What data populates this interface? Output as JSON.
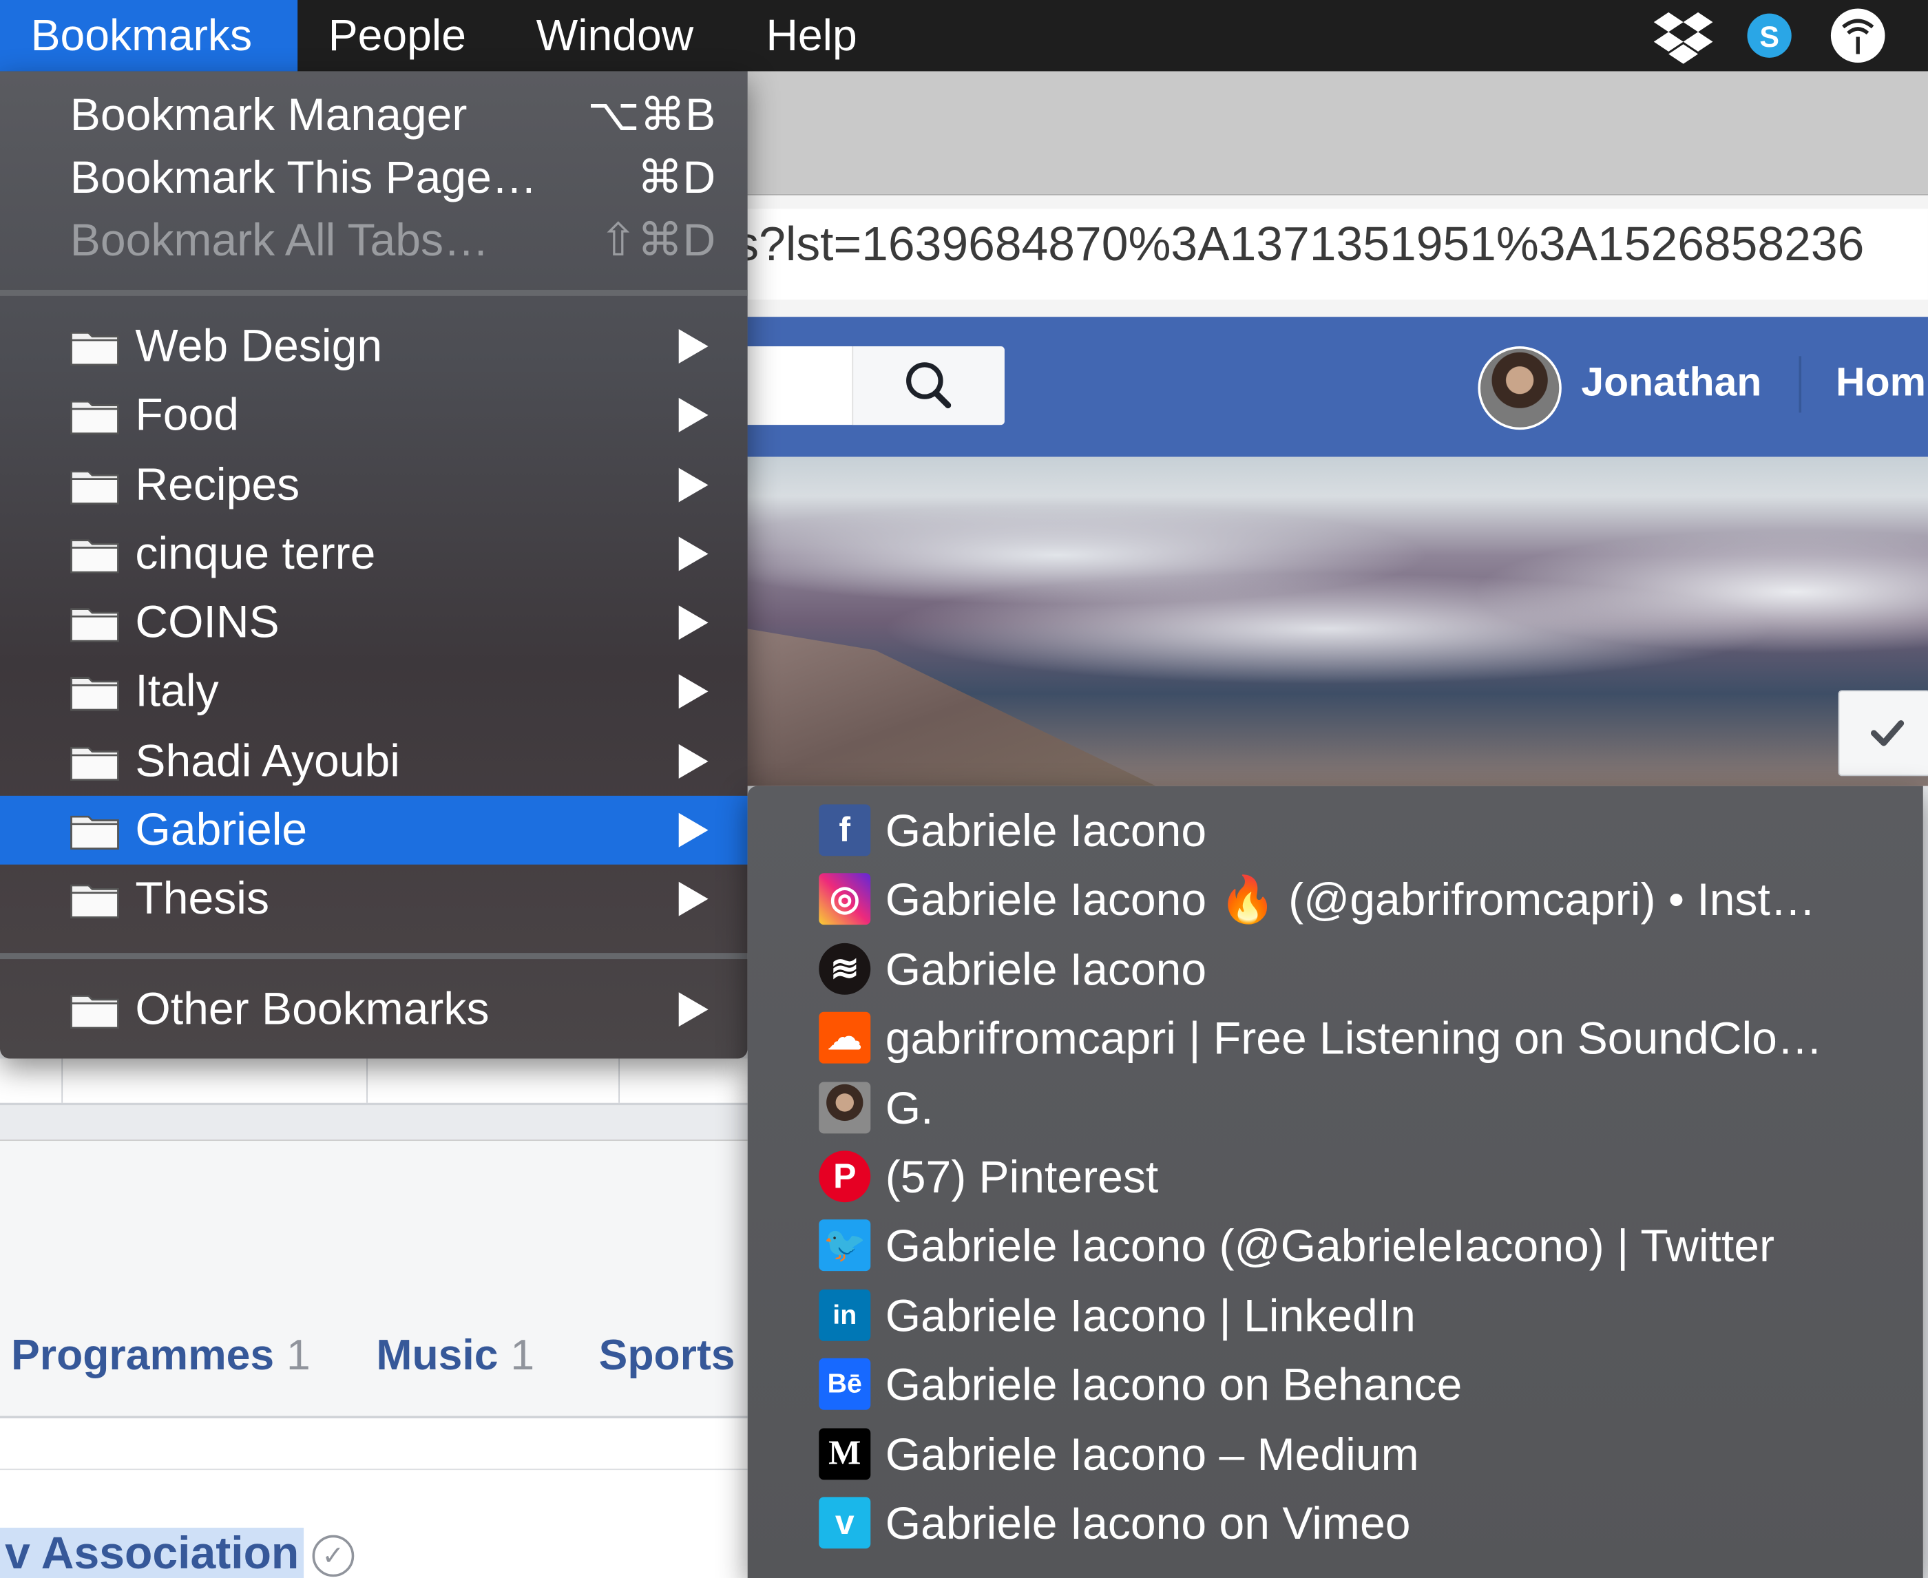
{
  "menubar": {
    "items": [
      "Bookmarks",
      "People",
      "Window",
      "Help"
    ],
    "tray_icons": [
      "dropbox-icon",
      "skype-icon",
      "wifi-signal-icon"
    ]
  },
  "browser": {
    "url": "es?lst=1639684870%3A1371351951%3A1526858236",
    "profile_name": "Jonathan",
    "home_link": "Hom",
    "tabs": [
      {
        "label": "Programmes",
        "count": "1"
      },
      {
        "label": "Music",
        "count": "1"
      },
      {
        "label": "Sports",
        "count": ""
      }
    ],
    "page_name": "v Association"
  },
  "bookmarks_menu": {
    "actions": [
      {
        "label": "Bookmark Manager",
        "shortcut": "⌥⌘B",
        "enabled": true
      },
      {
        "label": "Bookmark This Page…",
        "shortcut": "⌘D",
        "enabled": true
      },
      {
        "label": "Bookmark All Tabs…",
        "shortcut": "⇧⌘D",
        "enabled": false
      }
    ],
    "folders": [
      "Web Design",
      "Food",
      "Recipes",
      "cinque terre",
      "COINS",
      "Italy",
      "Shadi Ayoubi",
      "Gabriele",
      "Thesis"
    ],
    "selected_folder": "Gabriele",
    "other": "Other Bookmarks"
  },
  "submenu": {
    "items": [
      {
        "label": "Gabriele Iacono",
        "icon": "facebook-icon",
        "color": "#3b5998"
      },
      {
        "label": "Gabriele Iacono 🔥 (@gabrifromcapri) • Inst…",
        "icon": "instagram-icon",
        "color": "#d6249f"
      },
      {
        "label": "Gabriele Iacono",
        "icon": "spotify-icon",
        "color": "#191414"
      },
      {
        "label": "gabrifromcapri | Free Listening on SoundClo…",
        "icon": "soundcloud-icon",
        "color": "#ff5500"
      },
      {
        "label": "G.",
        "icon": "avatar-photo-icon",
        "color": "#8a8a8a"
      },
      {
        "label": "(57) Pinterest",
        "icon": "pinterest-icon",
        "color": "#e60023"
      },
      {
        "label": "Gabriele Iacono (@GabrieleIacono) | Twitter",
        "icon": "twitter-icon",
        "color": "#1da1f2"
      },
      {
        "label": "Gabriele Iacono | LinkedIn",
        "icon": "linkedin-icon",
        "color": "#0077b5"
      },
      {
        "label": "Gabriele Iacono on Behance",
        "icon": "behance-icon",
        "color": "#1769ff"
      },
      {
        "label": "Gabriele Iacono – Medium",
        "icon": "medium-icon",
        "color": "#000000"
      },
      {
        "label": "Gabriele Iacono on Vimeo",
        "icon": "vimeo-icon",
        "color": "#1ab7ea"
      }
    ]
  },
  "colors": {
    "accent": "#1c6fe0",
    "facebook_blue": "#4267b2"
  }
}
